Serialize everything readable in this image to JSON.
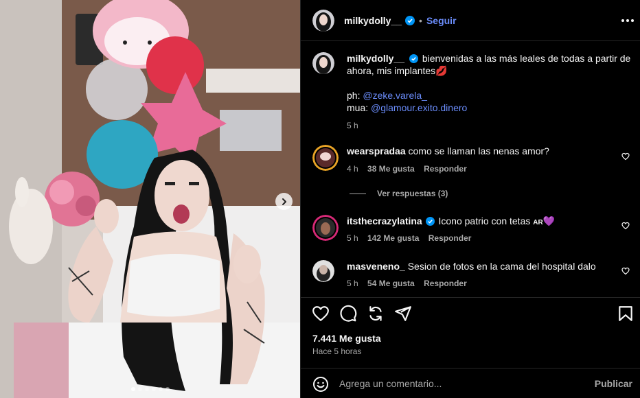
{
  "post": {
    "author": "milkydolly__",
    "verified": true,
    "follow_label": "Seguir",
    "separator": "•",
    "carousel_dots": 6,
    "carousel_active_index": 0
  },
  "caption": {
    "username": "milkydolly__",
    "text": "bienvenidas a las más leales de todas a partir de ahora, mis implantes",
    "emoji": "💋",
    "ph_label": "ph:",
    "ph_mention": "@zeke.varela_",
    "mua_label": "mua:",
    "mua_mention": "@glamour.exito.dinero",
    "time": "5 h"
  },
  "comments": [
    {
      "username": "wearspradaa",
      "verified": false,
      "text": "como se llaman las nenas amor?",
      "time": "4 h",
      "likes": "38 Me gusta",
      "reply_label": "Responder",
      "view_replies": "Ver respuestas (3)"
    },
    {
      "username": "itsthecrazylatina",
      "verified": true,
      "text": "Icono patrio con tetas",
      "badge": "AR",
      "emoji": "💜",
      "time": "5 h",
      "likes": "142 Me gusta",
      "reply_label": "Responder"
    },
    {
      "username": "masveneno_",
      "verified": false,
      "text": "Sesion de fotos en la cama del hospital dalo",
      "time": "5 h",
      "likes": "54 Me gusta",
      "reply_label": "Responder"
    }
  ],
  "stats": {
    "likes": "7.441 Me gusta",
    "posted": "Hace 5 horas"
  },
  "add_comment": {
    "placeholder": "Agrega un comentario...",
    "publish_label": "Publicar"
  },
  "colors": {
    "accent": "#6b8dfb",
    "verified": "#0095f6",
    "muted": "#a8a8a8",
    "background": "#000000"
  },
  "icons": [
    "verified-badge-icon",
    "more-options-icon",
    "heart-icon",
    "comment-icon",
    "repost-icon",
    "share-icon",
    "bookmark-icon",
    "emoji-icon",
    "chevron-right-icon"
  ]
}
